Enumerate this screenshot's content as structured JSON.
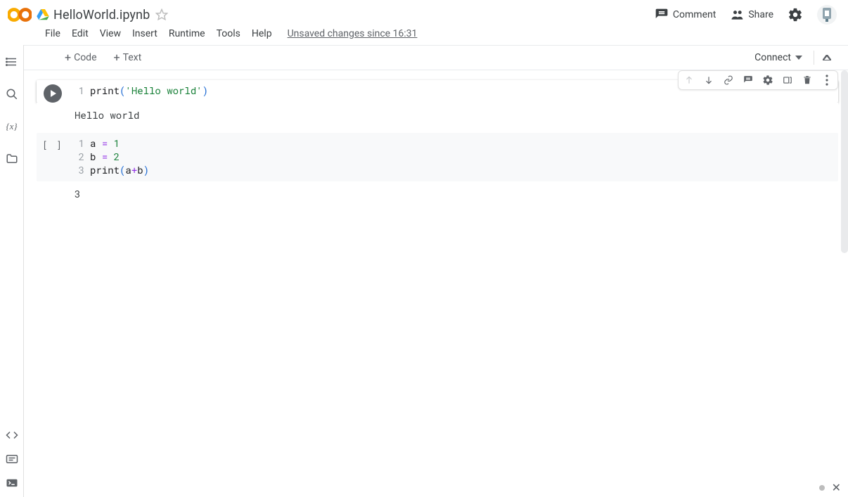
{
  "header": {
    "file_title": "HelloWorld.ipynb",
    "comment_label": "Comment",
    "share_label": "Share"
  },
  "menu": {
    "items": [
      "File",
      "Edit",
      "View",
      "Insert",
      "Runtime",
      "Tools",
      "Help"
    ],
    "status": "Unsaved changes since 16:31"
  },
  "toolbar": {
    "code_label": "Code",
    "text_label": "Text",
    "connect_label": "Connect"
  },
  "cells": [
    {
      "focused": true,
      "lines": [
        {
          "n": "1",
          "tokens": [
            {
              "t": "print",
              "c": "tok-fn"
            },
            {
              "t": "(",
              "c": "tok-paren"
            },
            {
              "t": "'Hello world'",
              "c": "tok-str"
            },
            {
              "t": ")",
              "c": "tok-paren"
            }
          ]
        }
      ],
      "output": "Hello world"
    },
    {
      "focused": false,
      "exec_indicator": "[ ]",
      "lines": [
        {
          "n": "1",
          "tokens": [
            {
              "t": "a ",
              "c": "tok-id"
            },
            {
              "t": "=",
              "c": "tok-op"
            },
            {
              "t": " ",
              "c": ""
            },
            {
              "t": "1",
              "c": "tok-num"
            }
          ]
        },
        {
          "n": "2",
          "tokens": [
            {
              "t": "b ",
              "c": "tok-id"
            },
            {
              "t": "=",
              "c": "tok-op"
            },
            {
              "t": " ",
              "c": ""
            },
            {
              "t": "2",
              "c": "tok-num"
            }
          ]
        },
        {
          "n": "3",
          "tokens": [
            {
              "t": "print",
              "c": "tok-fn"
            },
            {
              "t": "(",
              "c": "tok-paren"
            },
            {
              "t": "a",
              "c": "tok-id"
            },
            {
              "t": "+",
              "c": "tok-op"
            },
            {
              "t": "b",
              "c": "tok-id"
            },
            {
              "t": ")",
              "c": "tok-paren"
            }
          ]
        }
      ],
      "output": "3"
    }
  ]
}
